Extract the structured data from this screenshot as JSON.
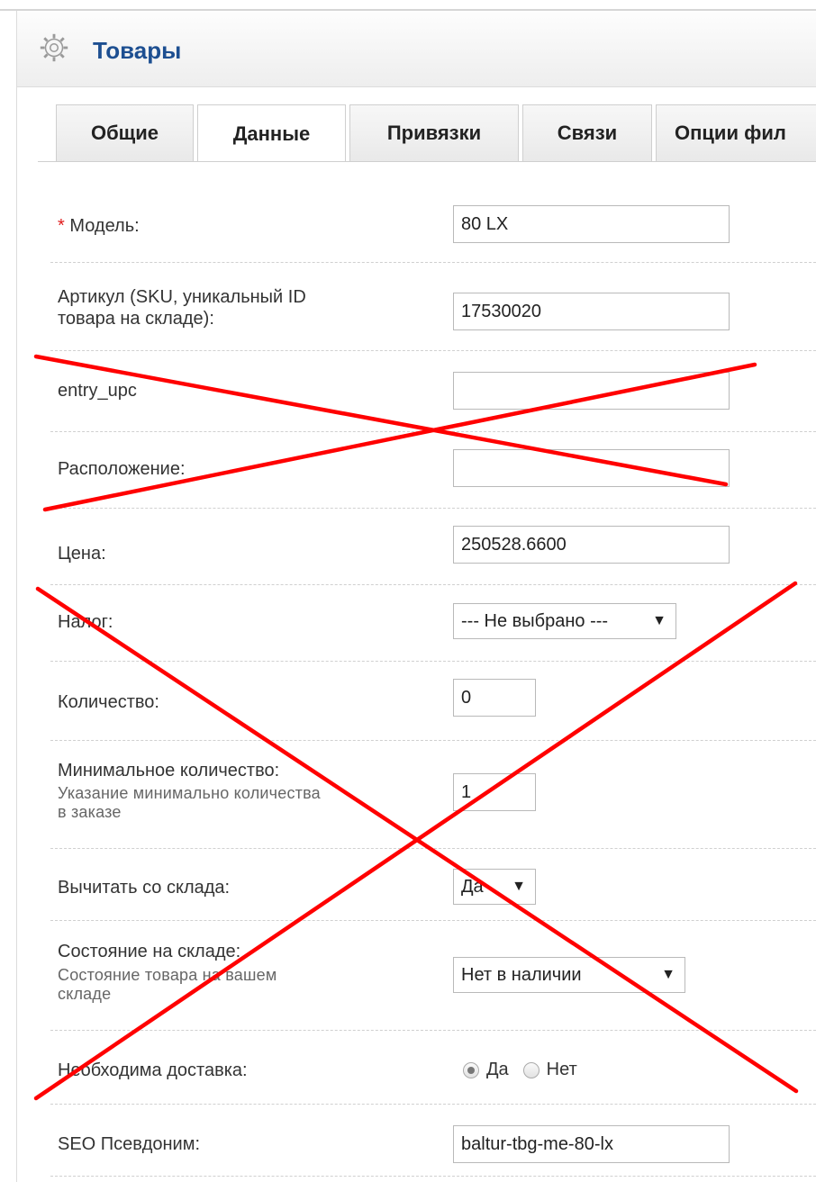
{
  "header": {
    "title": "Товары",
    "icon": "gear-icon"
  },
  "tabs": [
    {
      "label": "Общие",
      "active": false
    },
    {
      "label": "Данные",
      "active": true
    },
    {
      "label": "Привязки",
      "active": false
    },
    {
      "label": "Связи",
      "active": false
    },
    {
      "label": "Опции фил",
      "active": false
    }
  ],
  "fields": {
    "model": {
      "required_mark": "*",
      "label": "Модель:",
      "value": "80 LX"
    },
    "sku": {
      "label_line1": "Артикул (SKU, уникальный ID",
      "label_line2": "товара на складе):",
      "value": "17530020"
    },
    "upc": {
      "label": "entry_upc",
      "value": ""
    },
    "location": {
      "label": "Расположение:",
      "value": ""
    },
    "price": {
      "label": "Цена:",
      "value": "250528.6600"
    },
    "tax": {
      "label": "Налог:",
      "selected": "--- Не выбрано ---"
    },
    "quantity": {
      "label": "Количество:",
      "value": "0"
    },
    "minimum": {
      "label": "Минимальное количество:",
      "help_line1": "Указание минимально количества",
      "help_line2": "в заказе",
      "value": "1"
    },
    "subtract": {
      "label": "Вычитать со склада:",
      "selected": "Да"
    },
    "stock_status": {
      "label": "Состояние на складе:",
      "help_line1": "Состояние товара на вашем",
      "help_line2": "складе",
      "selected": "Нет в наличии"
    },
    "shipping": {
      "label": "Необходима доставка:",
      "option_yes": "Да",
      "option_no": "Нет",
      "selected": "Да"
    },
    "seo": {
      "label": "SEO Псевдоним:",
      "value": "baltur-tbg-me-80-lx"
    }
  },
  "annotation_color": "#ff0000"
}
